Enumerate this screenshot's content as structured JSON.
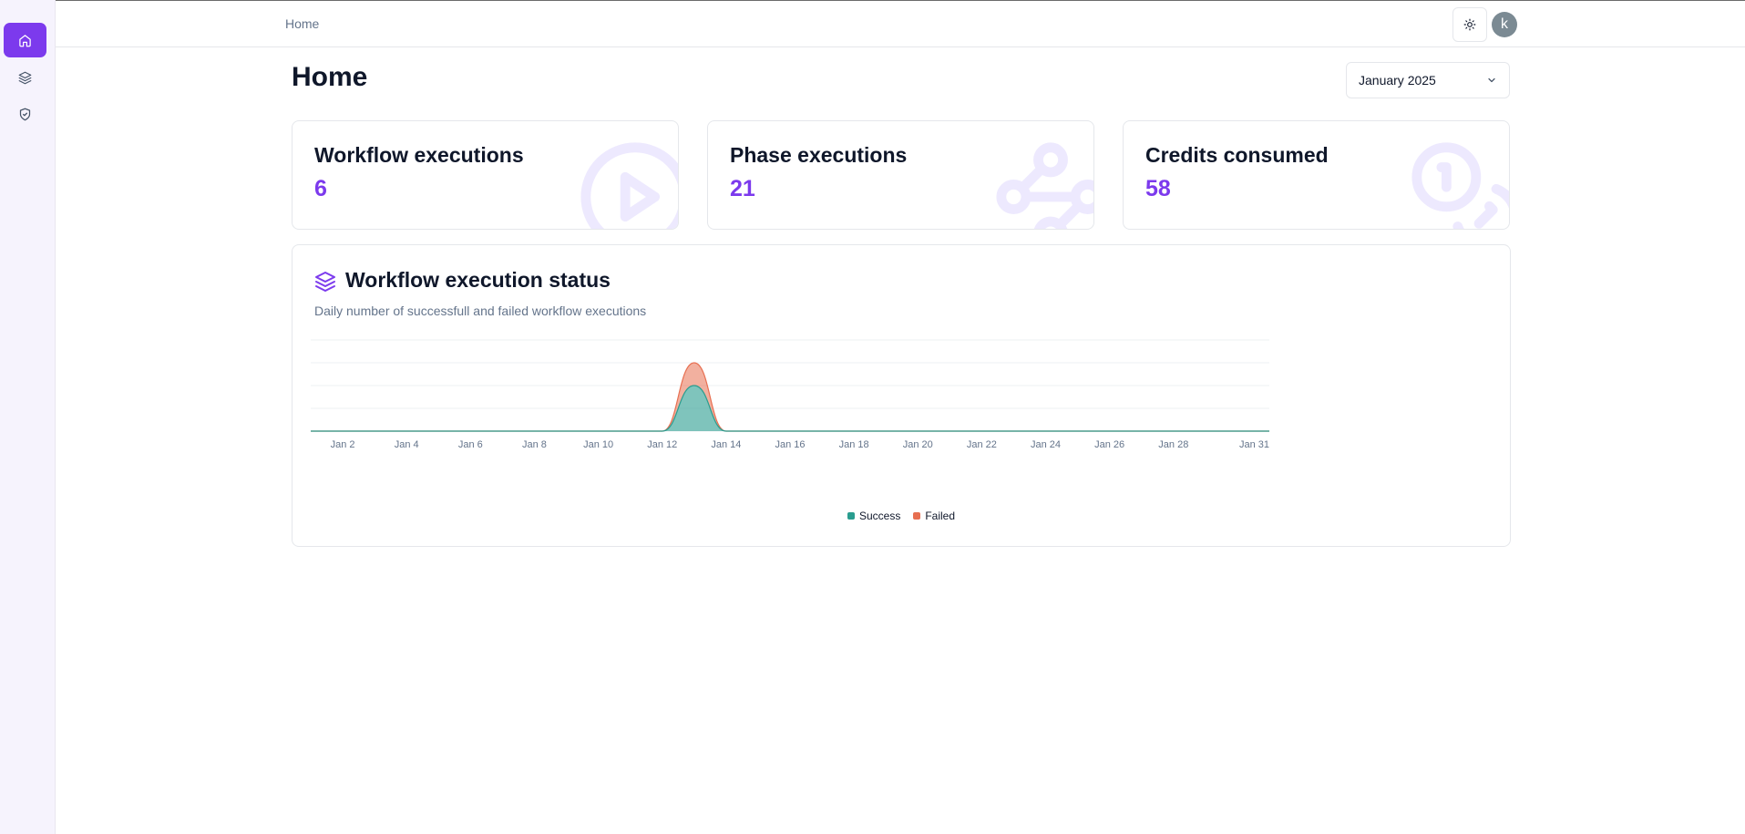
{
  "nav": [
    {
      "name": "home",
      "icon": "home-icon",
      "active": true
    },
    {
      "name": "workflows",
      "icon": "layers-icon",
      "active": false
    },
    {
      "name": "credentials",
      "icon": "shield-check-icon",
      "active": false
    }
  ],
  "topbar": {
    "breadcrumb": "Home",
    "theme_icon": "sun-icon",
    "avatar_initial": "k"
  },
  "page": {
    "title": "Home",
    "period": "January 2025"
  },
  "stats": [
    {
      "label": "Workflow executions",
      "value": "6",
      "icon": "circle-play-icon"
    },
    {
      "label": "Phase executions",
      "value": "21",
      "icon": "waypoints-icon"
    },
    {
      "label": "Credits consumed",
      "value": "58",
      "icon": "coins-icon"
    }
  ],
  "colors": {
    "accent": "#7c3aed",
    "success": "#2a9d8f",
    "failed": "#e76f51"
  },
  "chart": {
    "title": "Workflow execution status",
    "subtitle": "Daily number of successfull and failed workflow executions",
    "legend": [
      "Success",
      "Failed"
    ]
  },
  "chart_data": {
    "type": "area",
    "stacked": true,
    "x_ticks": [
      "Jan 2",
      "Jan 4",
      "Jan 6",
      "Jan 8",
      "Jan 10",
      "Jan 12",
      "Jan 14",
      "Jan 16",
      "Jan 18",
      "Jan 20",
      "Jan 22",
      "Jan 24",
      "Jan 26",
      "Jan 28",
      "Jan 31"
    ],
    "x": [
      "Jan 1",
      "Jan 2",
      "Jan 3",
      "Jan 4",
      "Jan 5",
      "Jan 6",
      "Jan 7",
      "Jan 8",
      "Jan 9",
      "Jan 10",
      "Jan 11",
      "Jan 12",
      "Jan 13",
      "Jan 14",
      "Jan 15",
      "Jan 16",
      "Jan 17",
      "Jan 18",
      "Jan 19",
      "Jan 20",
      "Jan 21",
      "Jan 22",
      "Jan 23",
      "Jan 24",
      "Jan 25",
      "Jan 26",
      "Jan 27",
      "Jan 28",
      "Jan 29",
      "Jan 30",
      "Jan 31"
    ],
    "series": [
      {
        "name": "Success",
        "values": [
          0,
          0,
          0,
          0,
          0,
          0,
          0,
          0,
          0,
          0,
          0,
          0,
          4,
          0,
          0,
          0,
          0,
          0,
          0,
          0,
          0,
          0,
          0,
          0,
          0,
          0,
          0,
          0,
          0,
          0,
          0
        ]
      },
      {
        "name": "Failed",
        "values": [
          0,
          0,
          0,
          0,
          0,
          0,
          0,
          0,
          0,
          0,
          0,
          0,
          2,
          0,
          0,
          0,
          0,
          0,
          0,
          0,
          0,
          0,
          0,
          0,
          0,
          0,
          0,
          0,
          0,
          0,
          0
        ]
      }
    ],
    "ylim": [
      0,
      8
    ],
    "grid": true,
    "legend_position": "bottom"
  }
}
